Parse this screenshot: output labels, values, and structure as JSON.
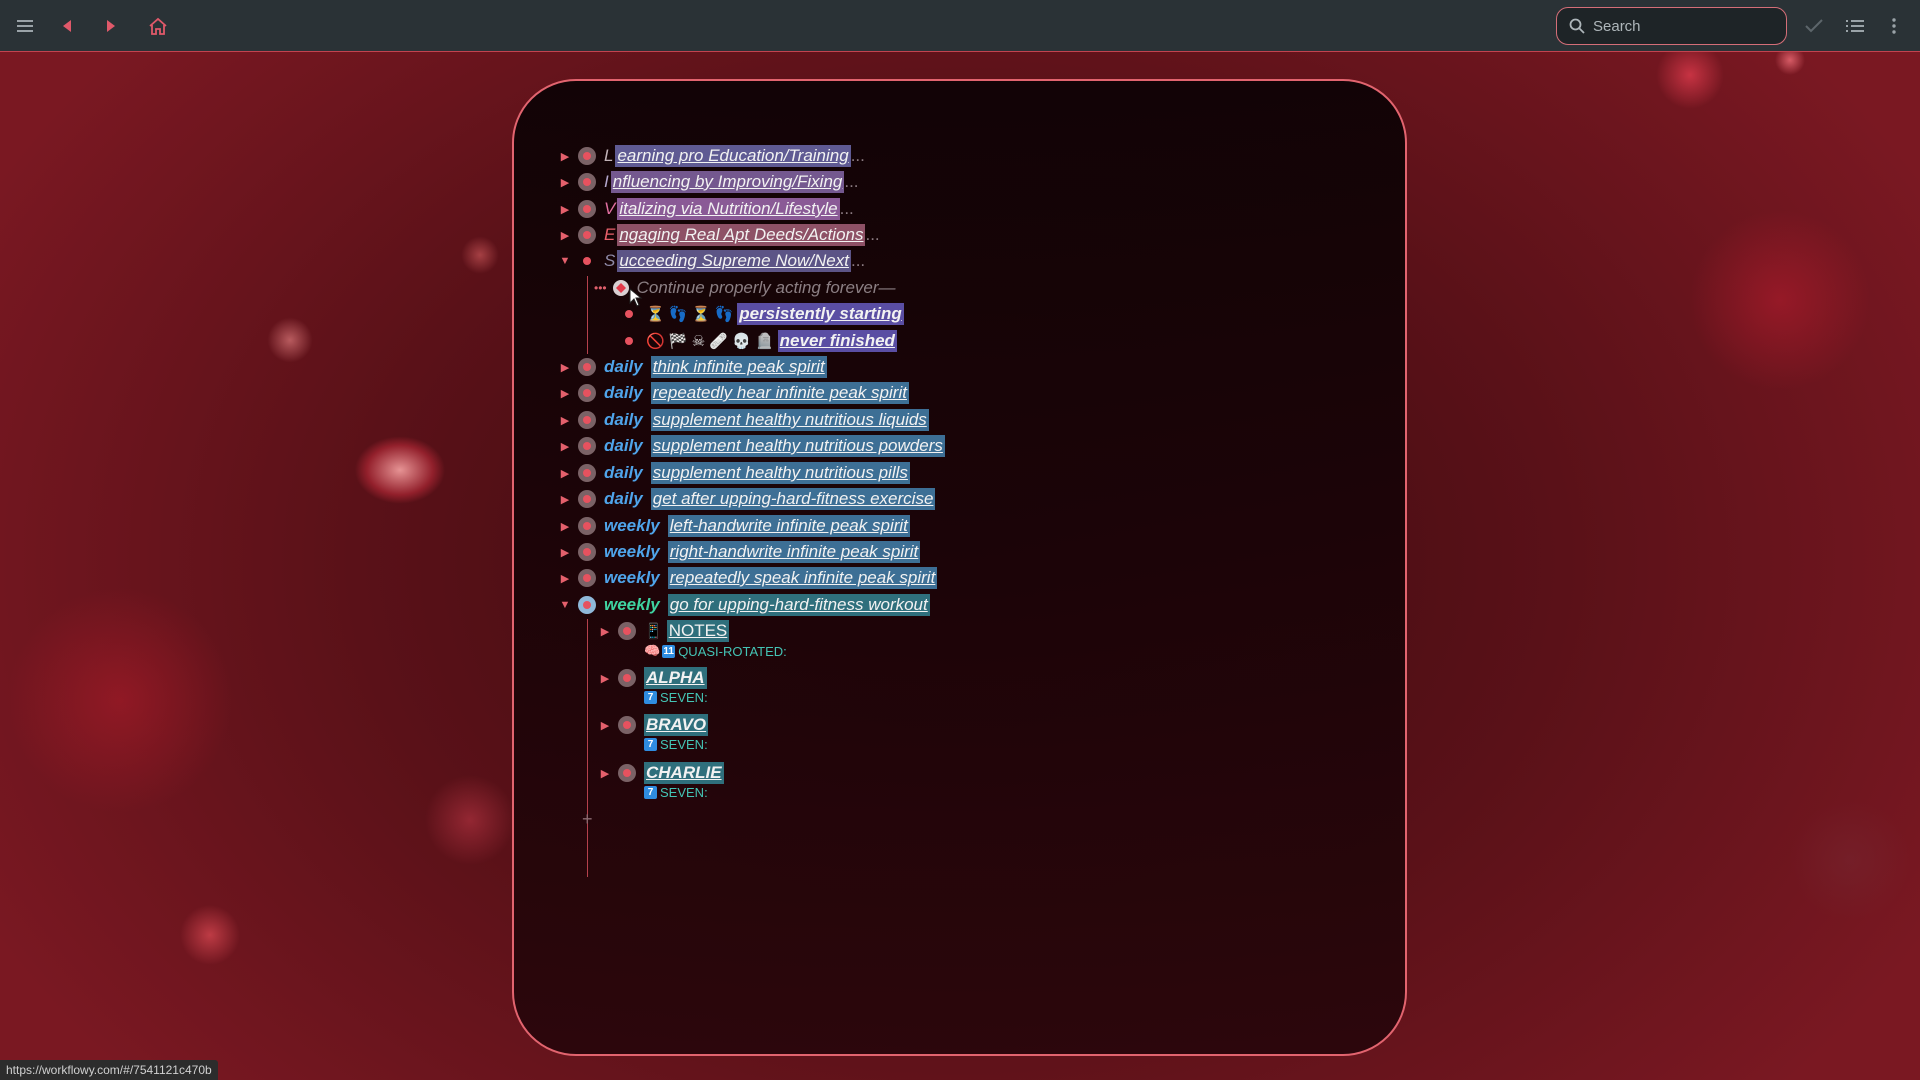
{
  "topbar": {
    "search_placeholder": "Search",
    "icons": [
      "menu-icon",
      "back-icon",
      "forward-icon",
      "home-icon",
      "check-icon",
      "list-icon",
      "more-icon"
    ]
  },
  "rows": [
    {
      "letter": "L",
      "text": "earning pro Education/Training",
      "trail": "..."
    },
    {
      "letter": "I",
      "text": "nfluencing by Improving/Fixing",
      "trail": "..."
    },
    {
      "letter": "V",
      "text": "italizing via Nutrition/Lifestyle",
      "trail": "..."
    },
    {
      "letter": "E",
      "text": "ngaging Real Apt Deeds/Actions",
      "trail": "..."
    },
    {
      "letter": "S",
      "text": "ucceeding Supreme Now/Next",
      "trail": "..."
    }
  ],
  "s_children": {
    "dots": "•••",
    "continue": "Continue properly acting forever—",
    "persist_emojis": "⏳ 👣 ⏳ 👣",
    "persist": "persistently starting",
    "never_emojis": "🚫 🏁 ☠ 🩹 💀 🪦",
    "never": "never finished"
  },
  "habits": [
    {
      "freq": "daily",
      "text": "think infinite peak spirit"
    },
    {
      "freq": "daily",
      "text": "repeatedly hear infinite peak spirit"
    },
    {
      "freq": "daily",
      "text": "supplement healthy nutritious liquids"
    },
    {
      "freq": "daily",
      "text": "supplement healthy nutritious powders"
    },
    {
      "freq": "daily",
      "text": "supplement healthy nutritious pills"
    },
    {
      "freq": "daily",
      "text": "get after upping-hard-fitness exercise"
    },
    {
      "freq": "weekly",
      "text": "left-handwrite infinite peak spirit"
    },
    {
      "freq": "weekly",
      "text": "right-handwrite infinite peak spirit"
    },
    {
      "freq": "weekly",
      "text": "repeatedly speak infinite peak spirit"
    },
    {
      "freq": "weekly",
      "text": "go for upping-hard-fitness workout"
    }
  ],
  "workout_children": [
    {
      "title": "NOTES",
      "icon": "📱",
      "sub_icon": "🧠",
      "badge": "11",
      "sub": "QUASI-ROTATED:"
    },
    {
      "title": "ALPHA",
      "badge": "7",
      "sub": "SEVEN:"
    },
    {
      "title": "BRAVO",
      "badge": "7",
      "sub": "SEVEN:"
    },
    {
      "title": "CHARLIE",
      "badge": "7",
      "sub": "SEVEN:"
    }
  ],
  "add_label": "+",
  "status_url": "https://workflowy.com/#/7541121c470b",
  "colors": {
    "accent": "#e2646f",
    "topbar": "#2a3236",
    "daily": "#4fa4ea",
    "weekly_active": "#3fd3a1"
  }
}
